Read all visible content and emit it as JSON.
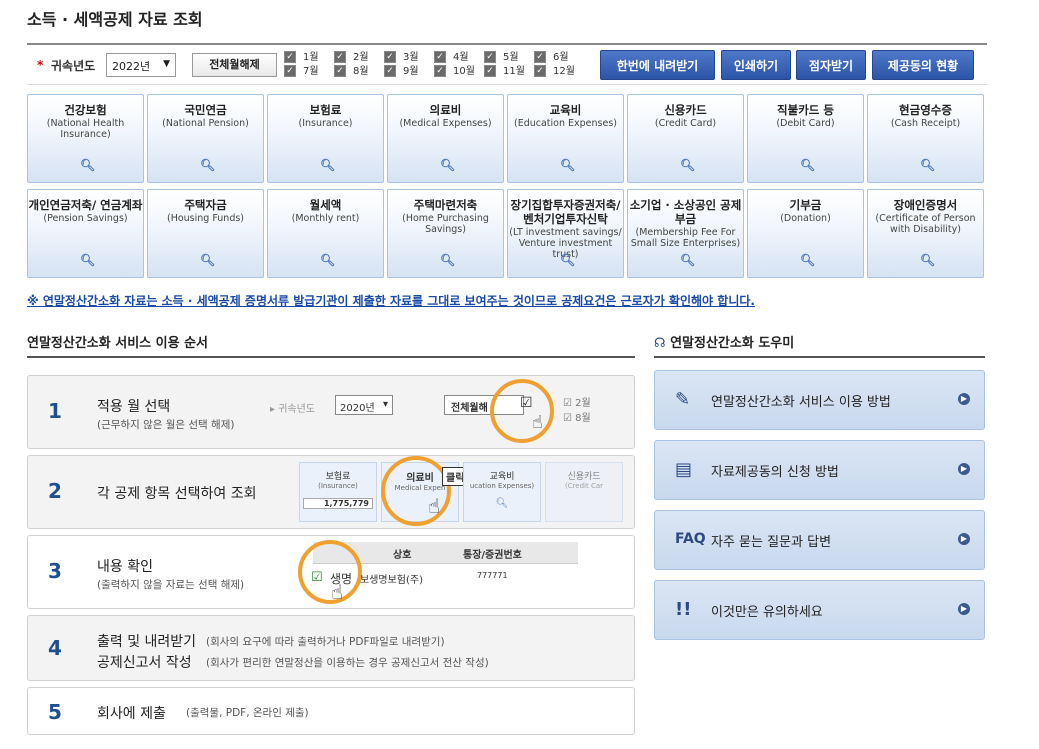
{
  "page_title": "소득 · 세액공제 자료 조회",
  "toolbar": {
    "year_label": "귀속년도",
    "year_value": "2022년",
    "clear_all": "전체월해제",
    "months": [
      "1월",
      "2월",
      "3월",
      "4월",
      "5월",
      "6월",
      "7월",
      "8월",
      "9월",
      "10월",
      "11월",
      "12월"
    ],
    "download_all": "한번에 내려받기",
    "print": "인쇄하기",
    "braille": "점자받기",
    "provider_status": "제공동의 현황"
  },
  "categories": [
    {
      "kr": "건강보험",
      "en": "(National Health Insurance)"
    },
    {
      "kr": "국민연금",
      "en": "(National Pension)"
    },
    {
      "kr": "보험료",
      "en": "(Insurance)"
    },
    {
      "kr": "의료비",
      "en": "(Medical Expenses)"
    },
    {
      "kr": "교육비",
      "en": "(Education Expenses)"
    },
    {
      "kr": "신용카드",
      "en": "(Credit Card)"
    },
    {
      "kr": "직불카드 등",
      "en": "(Debit Card)"
    },
    {
      "kr": "현금영수증",
      "en": "(Cash Receipt)"
    },
    {
      "kr": "개인연금저축/ 연금계좌",
      "en": "(Pension Savings)"
    },
    {
      "kr": "주택자금",
      "en": "(Housing Funds)"
    },
    {
      "kr": "월세액",
      "en": "(Monthly rent)"
    },
    {
      "kr": "주택마련저축",
      "en": "(Home Purchasing Savings)"
    },
    {
      "kr": "장기집합투자증권저축/ 벤처기업투자신탁",
      "en": "(LT investment savings/ Venture investment trust)"
    },
    {
      "kr": "소기업 · 소상공인 공제부금",
      "en": "(Membership Fee For Small Size Enterprises)"
    },
    {
      "kr": "기부금",
      "en": "(Donation)"
    },
    {
      "kr": "장애인증명서",
      "en": "(Certificate of Person with Disability)"
    }
  ],
  "notice": "※ 연말정산간소화 자료는 소득 · 세액공제 증명서류 발급기관이 제출한 자료를 그대로 보여주는 것이므로 공제요건은 근로자가 확인해야 합니다.",
  "steps_title": "연말정산간소화 서비스 이용 순서",
  "steps": [
    {
      "num": "1",
      "title": "적용 월 선택",
      "desc": "(근무하지 않은 월은 선택 해제)"
    },
    {
      "num": "2",
      "title": "각 공제 항목 선택하여 조회",
      "desc": ""
    },
    {
      "num": "3",
      "title": "내용 확인",
      "desc": "(출력하지 않을 자료는 선택 해제)"
    },
    {
      "num": "4",
      "title": "출력 및 내려받기",
      "title2": "공제신고서 작성",
      "desc": "(회사의 요구에 따라 출력하거나 PDF파일로 내려받기)",
      "desc2": "(회사가 편리한 연말정산을 이용하는 경우 공제신고서 전산 작성)"
    },
    {
      "num": "5",
      "title": "회사에 제출",
      "desc": "(출력물, PDF, 온라인 제출)"
    }
  ],
  "step_illus": {
    "s1_label": "귀속년도",
    "s1_year": "2020년",
    "s1_clear": "전체월해",
    "s2_tile1": "보험료",
    "s2_tile1_en": "(Insurance)",
    "s2_amount": "1,775,779",
    "s2_tile2": "의료비",
    "s2_tile2_en": "Medical Expen",
    "s2_click": "클릭!",
    "s2_tile3": "교육비",
    "s2_tile3_en": "ucation Expenses)",
    "s2_tile4": "신용카드",
    "s2_tile4_en": "(Credit Car",
    "s3_col1": "상호",
    "s3_col2": "통장/증권번호",
    "s3_row_name": "생명",
    "s3_row_company": "보생명보험(주)",
    "s3_row_no": "777771"
  },
  "helper_title": "연말정산간소화 도우미",
  "helpers": [
    {
      "icon": "✎",
      "label": "연말정산간소화 서비스 이용 방법"
    },
    {
      "icon": "▤",
      "label": "자료제공동의 신청 방법"
    },
    {
      "icon": "FAQ",
      "label": "자주 묻는 질문과 답변"
    },
    {
      "icon": "!!",
      "label": "이것만은 유의하세요"
    }
  ]
}
